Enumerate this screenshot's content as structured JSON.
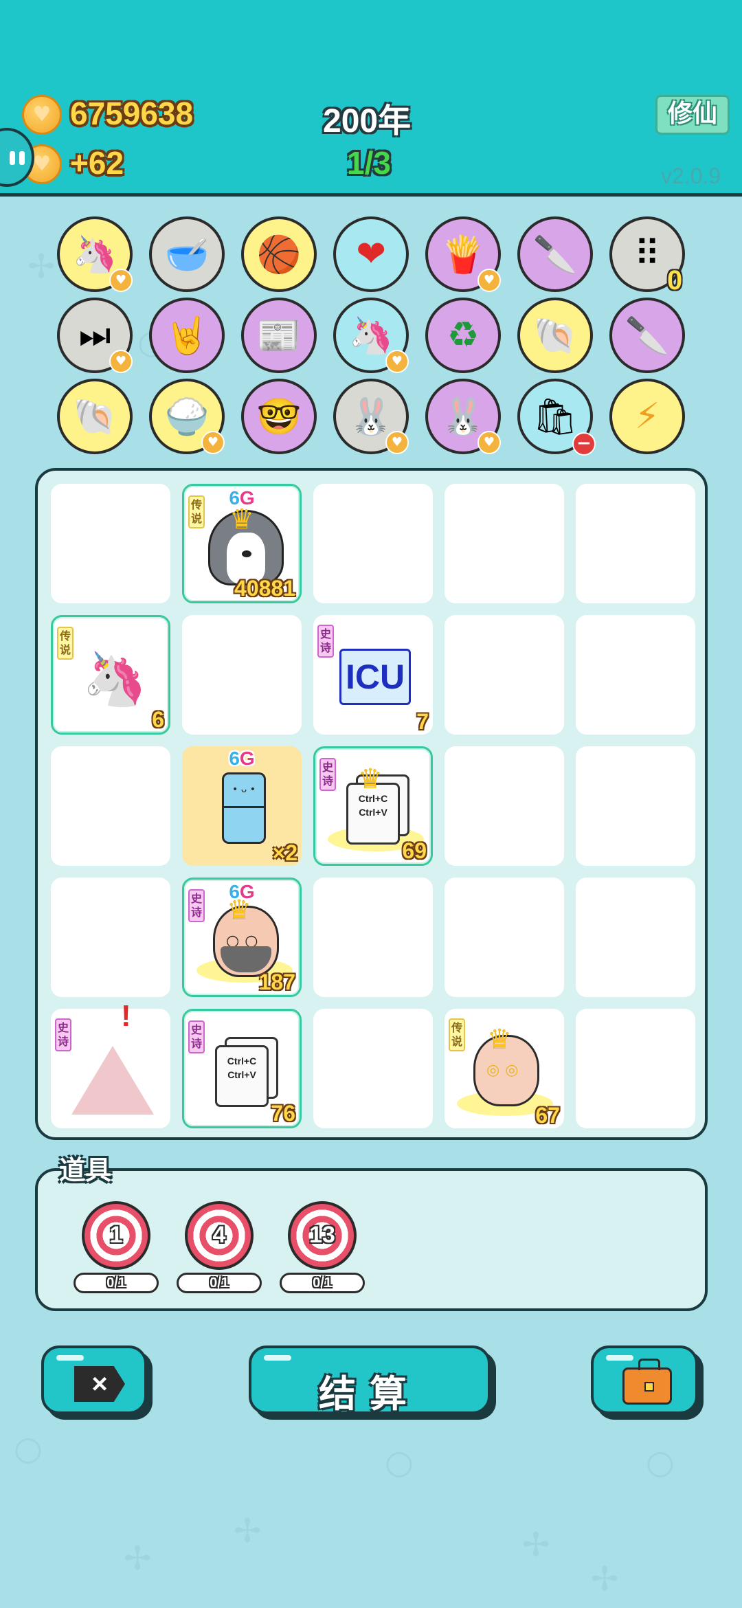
{
  "header": {
    "coins": "6759638",
    "income": "+62",
    "year": "200年",
    "turn": "1/3",
    "xiuxian_button": "修仙",
    "version": "v2.0.9"
  },
  "relics": [
    {
      "icon": "unicorn-icon",
      "glyph": "🦄"
    },
    {
      "icon": "dog-bowl-icon",
      "glyph": "🥣"
    },
    {
      "icon": "basketballs-icon",
      "glyph": "🏀"
    },
    {
      "icon": "heart-potion-icon",
      "glyph": "❤"
    },
    {
      "icon": "fries-icon",
      "glyph": "🍟"
    },
    {
      "icon": "cleaver-icon",
      "glyph": "🔪"
    },
    {
      "icon": "egg-tray-icon",
      "glyph": "⠿",
      "count": "0"
    },
    {
      "icon": "skip-icon",
      "glyph": "⏭"
    },
    {
      "icon": "rock-hand-icon",
      "glyph": "🤘"
    },
    {
      "icon": "time-magazine-icon",
      "glyph": "📰"
    },
    {
      "icon": "twin-unicorns-icon",
      "glyph": "🦄"
    },
    {
      "icon": "recycle-icon",
      "glyph": "♻"
    },
    {
      "icon": "shell-icon",
      "glyph": "🐚"
    },
    {
      "icon": "cleaver-icon",
      "glyph": "🔪"
    },
    {
      "icon": "shell-icon",
      "glyph": "🐚"
    },
    {
      "icon": "rice-bowl-icon",
      "glyph": "🍚"
    },
    {
      "icon": "math-nerd-icon",
      "glyph": "🤓"
    },
    {
      "icon": "bunny-icon",
      "glyph": "🐰"
    },
    {
      "icon": "bunny-icon",
      "glyph": "🐰"
    },
    {
      "icon": "trash-bag-icon",
      "glyph": "🛍"
    },
    {
      "icon": "lightning-icon",
      "glyph": "⚡"
    }
  ],
  "board": {
    "cells": [
      {
        "rarity": "传说",
        "tier": "6",
        "tier_g": "G",
        "value": "40881",
        "unit": "husky"
      },
      {
        "rarity": "传说",
        "value": "6",
        "unit": "unicorn"
      },
      {
        "rarity": "史诗",
        "value": "7",
        "unit": "icu",
        "icu_text": "ICU"
      },
      {
        "tier": "6",
        "tier_g": "G",
        "value": "×2",
        "unit": "fridge"
      },
      {
        "rarity": "史诗",
        "value": "69",
        "unit": "ctrl-paper",
        "line1": "Ctrl+C",
        "line2": "Ctrl+V"
      },
      {
        "rarity": "史诗",
        "tier": "6",
        "tier_g": "G",
        "value": "187",
        "unit": "bearded-man"
      },
      {
        "rarity": "史诗",
        "unit": "bunny-tent",
        "alert": "!"
      },
      {
        "rarity": "史诗",
        "value": "76",
        "unit": "ctrl-paper",
        "line1": "Ctrl+C",
        "line2": "Ctrl+V"
      },
      {
        "rarity": "传说",
        "value": "67",
        "unit": "old-man-glasses"
      }
    ]
  },
  "items": {
    "title": "道具",
    "list": [
      {
        "number": "1",
        "uses": "0/1"
      },
      {
        "number": "4",
        "uses": "0/1"
      },
      {
        "number": "13",
        "uses": "0/1"
      }
    ]
  },
  "buttons": {
    "exit": "×",
    "settle": "结算",
    "bag": "bag"
  },
  "colors": {
    "header": "#1ec6c9",
    "background": "#a9dfe6",
    "coin_text": "#ffd84a",
    "turn_text": "#46d84a",
    "legend_border": "#38c8a0"
  }
}
